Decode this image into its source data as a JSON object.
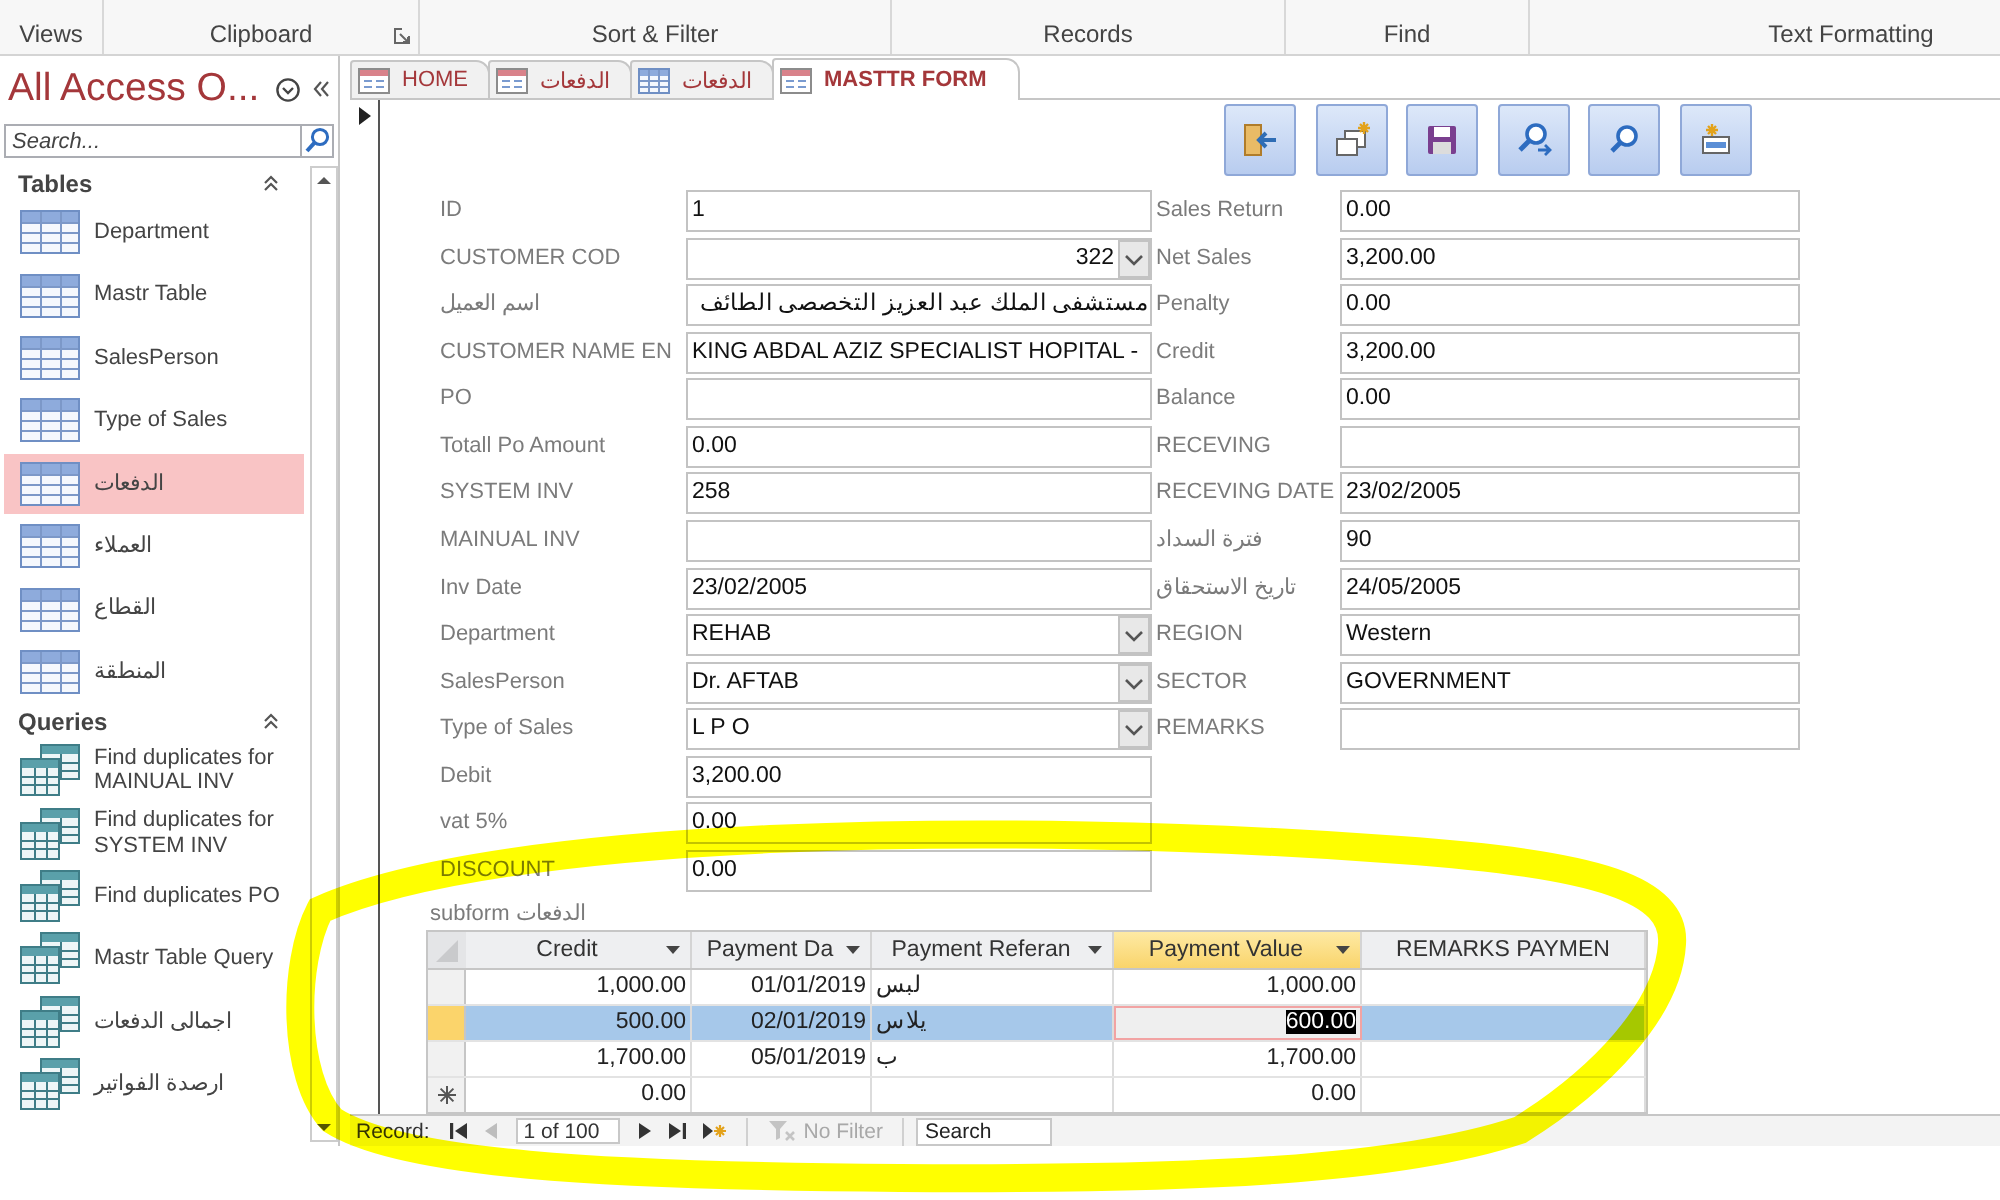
{
  "ribbon": {
    "groups": [
      {
        "label": "Views"
      },
      {
        "label": "Clipboard",
        "launcher": true
      },
      {
        "label": "Sort & Filter"
      },
      {
        "label": "Records"
      },
      {
        "label": "Find"
      },
      {
        "label": "Text Formatting"
      }
    ]
  },
  "nav_pane": {
    "title": "All Access O...",
    "search": {
      "placeholder": "Search..."
    },
    "sections": [
      {
        "title": "Tables",
        "kind": "table",
        "expanded": true,
        "items": [
          {
            "label": "Department",
            "selected": false
          },
          {
            "label": "Mastr Table",
            "selected": false
          },
          {
            "label": "SalesPerson",
            "selected": false
          },
          {
            "label": "Type of Sales",
            "selected": false
          },
          {
            "label": "الدفعات",
            "selected": true
          },
          {
            "label": "العملاء",
            "selected": false
          },
          {
            "label": "القطاع",
            "selected": false
          },
          {
            "label": "المنطقة",
            "selected": false
          }
        ]
      },
      {
        "title": "Queries",
        "kind": "query",
        "expanded": true,
        "items": [
          {
            "label": "Find duplicates for MAINUAL INV",
            "selected": false
          },
          {
            "label": "Find duplicates for SYSTEM INV",
            "selected": false
          },
          {
            "label": "Find duplicates PO",
            "selected": false
          },
          {
            "label": "Mastr Table Query",
            "selected": false
          },
          {
            "label": "اجمالى الدفعات",
            "selected": false
          },
          {
            "label": "ارصدة الفواتير",
            "selected": false
          }
        ]
      }
    ]
  },
  "tabs": [
    {
      "label": "HOME",
      "kind": "form",
      "selected": false
    },
    {
      "label": "الدفعات",
      "kind": "form",
      "selected": false
    },
    {
      "label": "الدفعات",
      "kind": "table",
      "selected": false
    },
    {
      "label": "MASTTR FORM",
      "kind": "form",
      "selected": true
    }
  ],
  "form": {
    "fields_left": [
      {
        "label": "ID",
        "kind": "text",
        "value": "1"
      },
      {
        "label": "CUSTOMER COD",
        "kind": "number-combo",
        "value": "322"
      },
      {
        "label": "اسم العميل",
        "kind": "text",
        "value": "مستشفى الملك عبد العزيز التخصصى الطائف"
      },
      {
        "label": "CUSTOMER NAME EN",
        "kind": "text",
        "value": "KING ABDAL AZIZ SPECIALIST HOPITAL -"
      },
      {
        "label": "PO",
        "kind": "text"
      },
      {
        "label": "Totall Po Amount",
        "kind": "text",
        "value": "0.00"
      },
      {
        "label": "SYSTEM INV",
        "kind": "text",
        "value": "258"
      },
      {
        "label": "MAINUAL INV",
        "kind": "text"
      },
      {
        "label": "Inv Date",
        "kind": "text",
        "value": "23/02/2005"
      },
      {
        "label": "Department",
        "kind": "combo",
        "value": "REHAB"
      },
      {
        "label": "SalesPerson",
        "kind": "combo",
        "value": "Dr. AFTAB"
      },
      {
        "label": "Type of Sales",
        "kind": "combo",
        "value": "L P O"
      },
      {
        "label": "Debit",
        "kind": "text",
        "value": "3,200.00"
      },
      {
        "label": "vat 5%",
        "kind": "text",
        "value": "0.00"
      },
      {
        "label": "DISCOUNT",
        "kind": "text",
        "value": "0.00"
      }
    ],
    "fields_right": [
      {
        "label": "Sales Return",
        "kind": "text",
        "value": "0.00"
      },
      {
        "label": "Net Sales",
        "kind": "text",
        "value": "3,200.00"
      },
      {
        "label": "Penalty",
        "kind": "text",
        "value": "0.00"
      },
      {
        "label": "Credit",
        "kind": "text",
        "value": "3,200.00"
      },
      {
        "label": "Balance",
        "kind": "text",
        "value": "0.00"
      },
      {
        "label": "RECEVING",
        "kind": "text"
      },
      {
        "label": "RECEVING DATE",
        "kind": "text",
        "value": "23/02/2005"
      },
      {
        "label": "فترة السداد",
        "kind": "text",
        "value": "90"
      },
      {
        "label": "تاريخ الاستحقاق",
        "kind": "text",
        "value": "24/05/2005"
      },
      {
        "label": "REGION",
        "kind": "text",
        "value": "Western"
      },
      {
        "label": "SECTOR",
        "kind": "text",
        "value": "GOVERNMENT"
      },
      {
        "label": "REMARKS",
        "kind": "text"
      }
    ]
  },
  "subform": {
    "label": "subform الدفعات",
    "columns": [
      {
        "label": "Credit",
        "kind": "number",
        "dropdown": true,
        "selected": false
      },
      {
        "label": "Payment Da",
        "kind": "date",
        "dropdown": true,
        "selected": false
      },
      {
        "label": "Payment Referan",
        "kind": "text",
        "dropdown": true,
        "selected": false
      },
      {
        "label": "Payment Value",
        "kind": "number",
        "dropdown": true,
        "selected": true
      },
      {
        "label": "REMARKS PAYMEN",
        "kind": "text",
        "dropdown": false,
        "selected": false
      }
    ],
    "rows": [
      {
        "kind": "record",
        "selected": false,
        "cells": [
          "1,000.00",
          "01/01/2019",
          "لبس",
          "1,000.00",
          null
        ]
      },
      {
        "kind": "record",
        "selected": true,
        "cells": [
          "500.00",
          "02/01/2019",
          "يلاس",
          "600.00",
          null
        ]
      },
      {
        "kind": "record",
        "selected": false,
        "cells": [
          "1,700.00",
          "05/01/2019",
          "ب",
          "1,700.00",
          null
        ]
      },
      {
        "kind": "new",
        "selected": false,
        "cells": [
          "0.00",
          null,
          null,
          "0.00",
          null
        ]
      }
    ]
  },
  "record_nav": {
    "label": "Record:",
    "buttons": [
      {
        "kind": "first",
        "disabled": false
      },
      {
        "kind": "prev",
        "disabled": true
      },
      {
        "kind": "next",
        "disabled": false
      },
      {
        "kind": "last",
        "disabled": false
      },
      {
        "kind": "new",
        "disabled": false
      }
    ],
    "position": "1 of 100",
    "filter": {
      "label": "No Filter",
      "disabled": true
    },
    "search": {
      "placeholder": "Search"
    }
  },
  "annotation": {
    "kind": "highlighter-loop"
  }
}
